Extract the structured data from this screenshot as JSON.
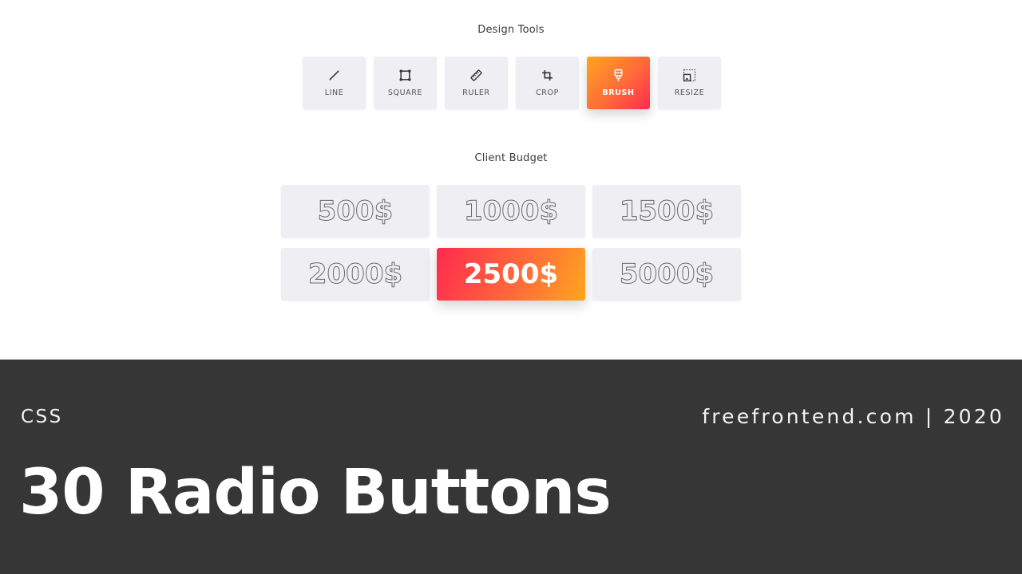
{
  "design_tools": {
    "title": "Design Tools",
    "selected": "BRUSH",
    "items": [
      {
        "label": "LINE",
        "icon": "line-icon"
      },
      {
        "label": "SQUARE",
        "icon": "square-icon"
      },
      {
        "label": "RULER",
        "icon": "ruler-icon"
      },
      {
        "label": "CROP",
        "icon": "crop-icon"
      },
      {
        "label": "BRUSH",
        "icon": "brush-icon"
      },
      {
        "label": "RESIZE",
        "icon": "resize-icon"
      }
    ]
  },
  "client_budget": {
    "title": "Client Budget",
    "selected": "2500$",
    "options": [
      "500$",
      "1000$",
      "1500$",
      "2000$",
      "2500$",
      "5000$"
    ]
  },
  "colors": {
    "gradient_start": "#ffa51f",
    "gradient_end": "#ff2a4f",
    "option_bg": "#efeef3",
    "banner_bg": "#363636"
  },
  "banner": {
    "category": "CSS",
    "site": "freefrontend.com | 2020",
    "headline": "30 Radio Buttons"
  }
}
